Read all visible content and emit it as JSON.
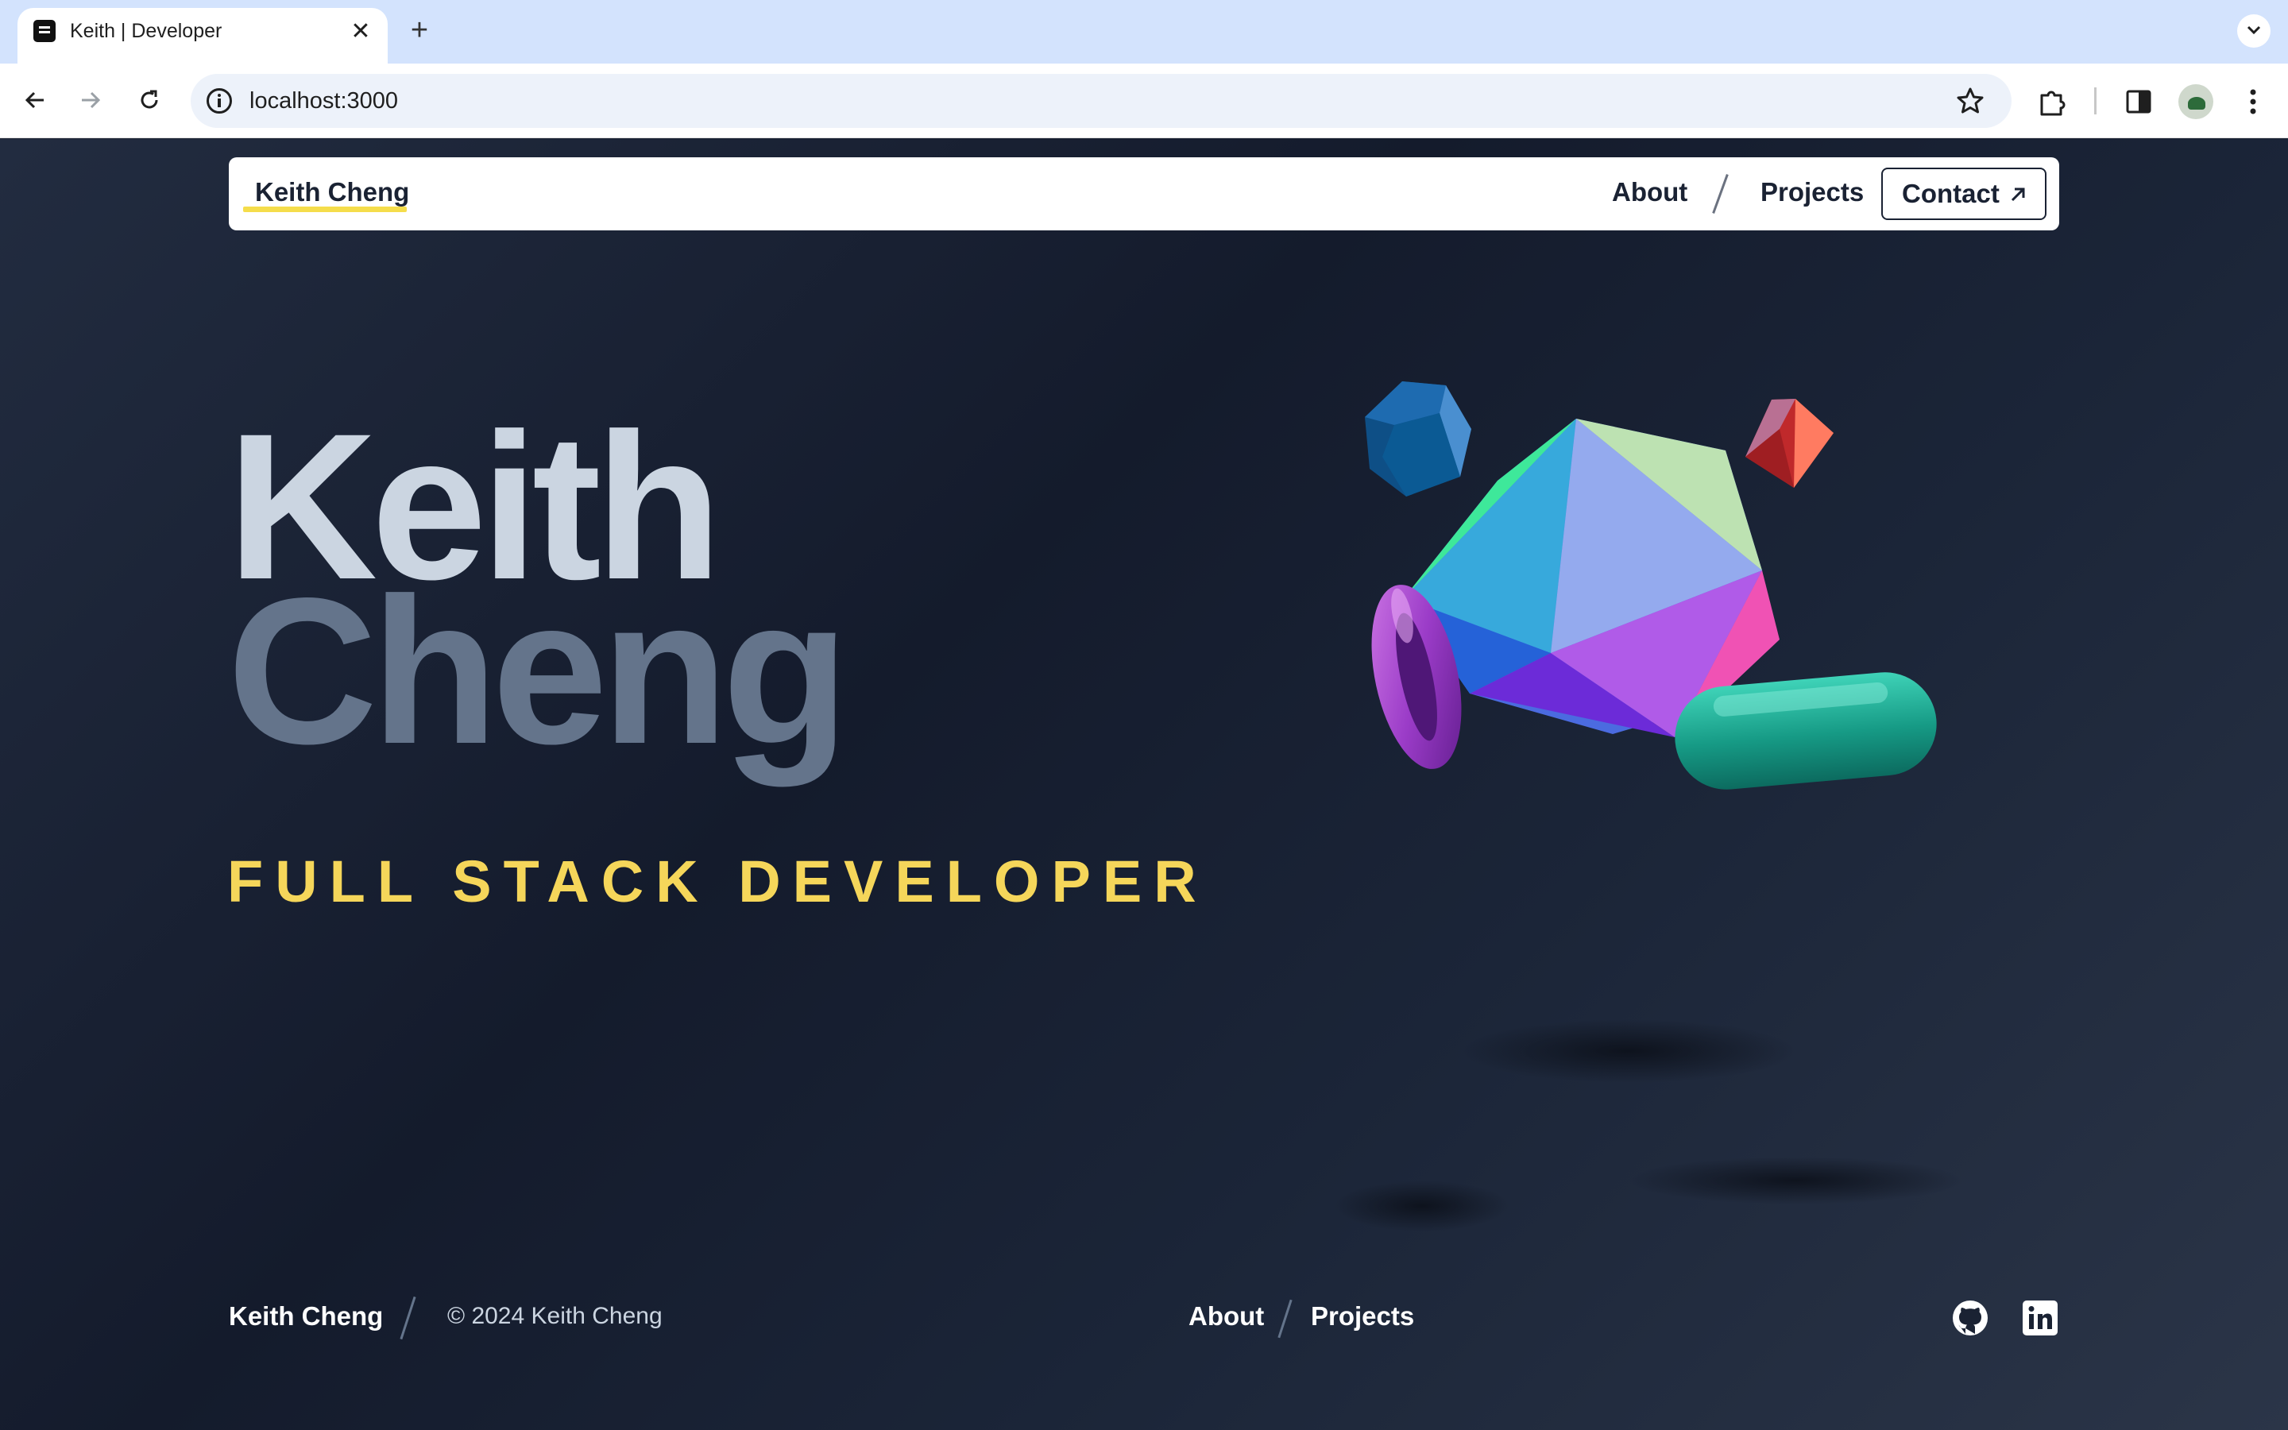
{
  "browser": {
    "tab_title": "Keith | Developer",
    "tab_close": "✕",
    "new_tab": "+",
    "url": "localhost:3000"
  },
  "nav": {
    "brand": "Keith Cheng",
    "links": [
      "About",
      "Projects"
    ],
    "contact": "Contact"
  },
  "hero": {
    "first_name": "Keith",
    "last_name": "Cheng",
    "role": "FULL STACK DEVELOPER"
  },
  "footer": {
    "brand": "Keith Cheng",
    "copyright": "© 2024 Keith Cheng",
    "links": [
      "About",
      "Projects"
    ],
    "social": [
      "github-icon",
      "linkedin-icon"
    ]
  },
  "colors": {
    "accent": "#f5d65a",
    "underline": "#f5dd4b",
    "hero_first": "#cbd5e1",
    "hero_last": "#64748b",
    "background": "#1a2233"
  }
}
